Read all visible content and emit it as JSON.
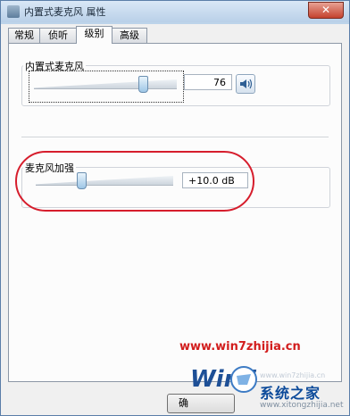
{
  "window": {
    "title": "内置式麦克风 属性",
    "close_glyph": "✕"
  },
  "tabs": [
    {
      "label": "常规",
      "active": false
    },
    {
      "label": "侦听",
      "active": false
    },
    {
      "label": "级别",
      "active": true
    },
    {
      "label": "高级",
      "active": false
    }
  ],
  "microphone": {
    "group_label": "内置式麦克风",
    "level": 76,
    "level_display": "76",
    "speaker_icon": "speaker-icon"
  },
  "boost": {
    "group_label": "麦克风加强",
    "value_display": "+10.0 dB",
    "level_fraction": 0.33
  },
  "buttons": {
    "ok_label": "确"
  },
  "watermark": {
    "url": "www.win7zhijia.cn",
    "logo_text": "Win7",
    "site_name": "系统之家",
    "domain_faint": "www.win7zhijia.cn",
    "domain": "www.xitongzhijia.net"
  },
  "colors": {
    "highlight": "#d61d2c",
    "watermark_red": "#d21d1d",
    "watermark_blue": "#0c4a9a"
  }
}
